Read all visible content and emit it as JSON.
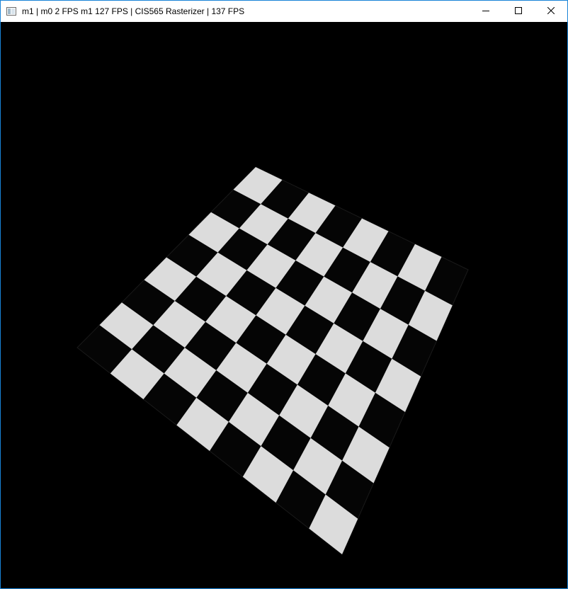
{
  "window": {
    "title": "m1 | m0 2 FPS m1 127 FPS | CIS565 Rasterizer | 137 FPS",
    "icon": "app-window-icon",
    "controls": {
      "minimize_icon": "minimize-icon",
      "maximize_icon": "maximize-icon",
      "close_icon": "close-icon"
    },
    "border_color": "#1883d7"
  },
  "viewport": {
    "background": "#000000",
    "scene": "checkerboard-plane",
    "light_tile_color": "#dcdcdc",
    "dark_tile_color": "#000000",
    "grid": [
      8,
      8
    ]
  }
}
